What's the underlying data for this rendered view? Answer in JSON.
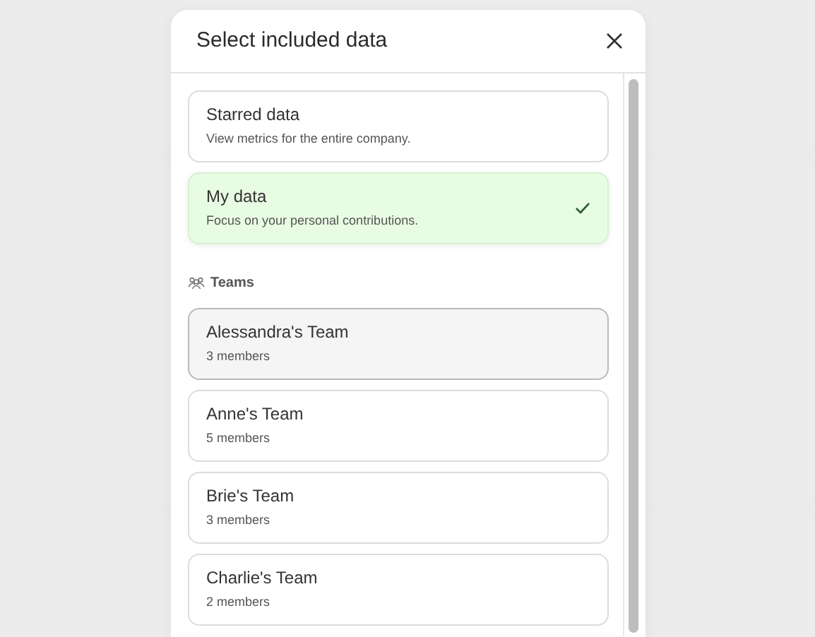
{
  "dialog": {
    "title": "Select included data"
  },
  "options": [
    {
      "title": "Starred data",
      "description": "View metrics for the entire company.",
      "selected": false
    },
    {
      "title": "My data",
      "description": "Focus on your personal contributions.",
      "selected": true
    }
  ],
  "teams_section": {
    "label": "Teams"
  },
  "teams": [
    {
      "name": "Alessandra's Team",
      "members": "3 members",
      "highlighted": true
    },
    {
      "name": "Anne's Team",
      "members": "5 members",
      "highlighted": false
    },
    {
      "name": "Brie's Team",
      "members": "3 members",
      "highlighted": false
    },
    {
      "name": "Charlie's Team",
      "members": "2 members",
      "highlighted": false
    }
  ]
}
